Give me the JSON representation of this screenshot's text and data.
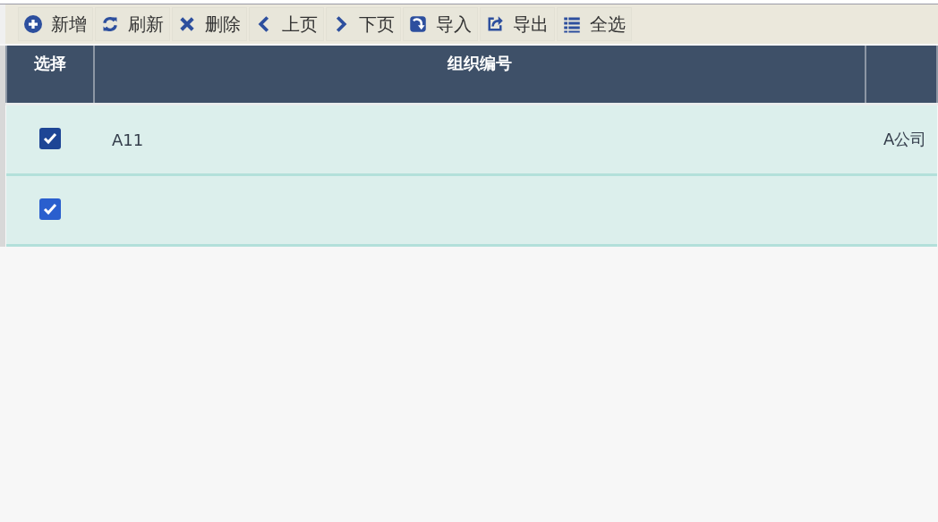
{
  "toolbar": [
    {
      "kind": "add",
      "label": "新增"
    },
    {
      "kind": "refresh",
      "label": "刷新"
    },
    {
      "kind": "delete",
      "label": "删除"
    },
    {
      "kind": "prev",
      "label": "上页"
    },
    {
      "kind": "next",
      "label": "下页"
    },
    {
      "kind": "import",
      "label": "导入"
    },
    {
      "kind": "export",
      "label": "导出"
    },
    {
      "kind": "select_all",
      "label": "全选"
    }
  ],
  "table": {
    "columns": [
      "选择",
      "组织编号"
    ],
    "rows": [
      {
        "checked": true,
        "org_code": "A11",
        "column_3": "A公司"
      },
      {
        "checked": true
      }
    ]
  }
}
